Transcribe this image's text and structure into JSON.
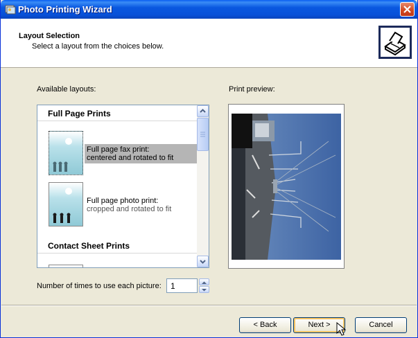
{
  "window": {
    "title": "Photo Printing Wizard",
    "close_icon": "close-icon"
  },
  "header": {
    "title": "Layout Selection",
    "subtitle": "Select a layout from the choices below.",
    "icon": "printer-wizard-icon"
  },
  "layouts": {
    "label": "Available layouts:",
    "groups": [
      {
        "name": "Full Page Prints",
        "items": [
          {
            "line1": "Full page fax print:",
            "line2": "centered and rotated to fit",
            "selected": true
          },
          {
            "line1": "Full page photo print:",
            "line2": "cropped and rotated to fit",
            "selected": false
          }
        ]
      },
      {
        "name": "Contact Sheet Prints",
        "items": []
      }
    ]
  },
  "preview": {
    "label": "Print preview:"
  },
  "copies": {
    "label": "Number of times to use each picture:",
    "value": "1"
  },
  "buttons": {
    "back": "< Back",
    "next": "Next >",
    "cancel": "Cancel"
  }
}
